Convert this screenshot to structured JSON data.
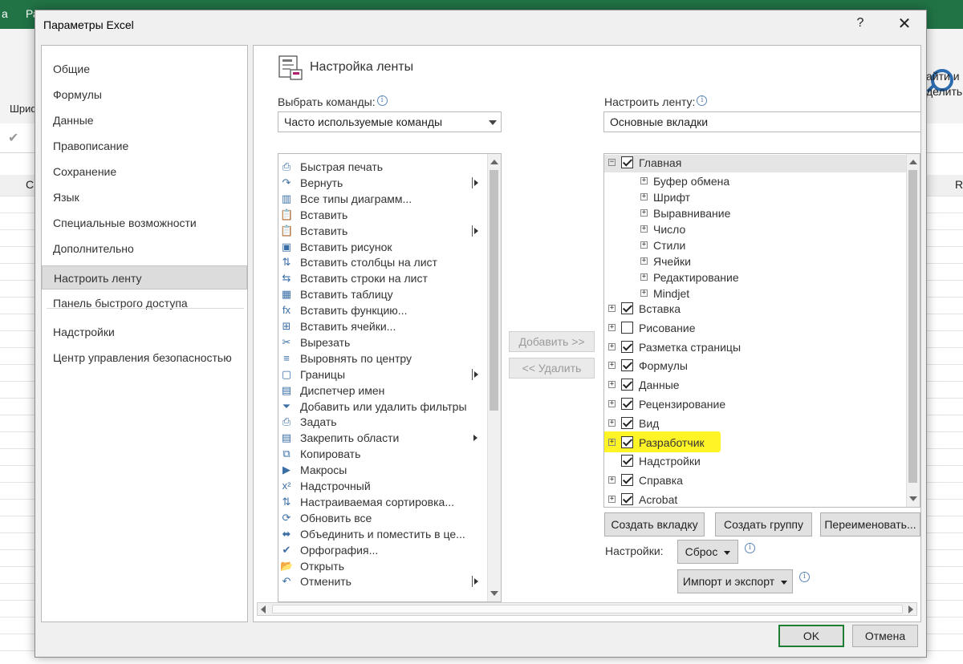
{
  "background": {
    "titlebar_frag_left": "а",
    "titlebar_frag_2": "Ра",
    "ribbon_frag_left": "Шриф",
    "ribbon_frag_right_1": "айти и",
    "ribbon_frag_right_2": "делить",
    "colhdr_frag_left": "С",
    "colhdr_frag_right": "R",
    "accent": "#217346"
  },
  "dialog": {
    "title": "Параметры Excel",
    "help": "?",
    "close": "✕",
    "nav": [
      {
        "label": "Общие"
      },
      {
        "label": "Формулы"
      },
      {
        "label": "Данные"
      },
      {
        "label": "Правописание"
      },
      {
        "label": "Сохранение"
      },
      {
        "label": "Язык"
      },
      {
        "label": "Специальные возможности"
      },
      {
        "label": "Дополнительно"
      },
      {
        "label": "Настроить ленту",
        "active": true
      },
      {
        "label": "Панель быстрого доступа"
      },
      {
        "label": "Надстройки"
      },
      {
        "label": "Центр управления безопасностью"
      }
    ],
    "section_title": "Настройка ленты",
    "choose_label": "Выбрать команды:",
    "choose_value": "Часто используемые команды",
    "customize_label": "Настроить ленту:",
    "customize_value": "Основные вкладки",
    "commands": [
      {
        "label": "Быстрая печать",
        "icon": "quick-print-icon",
        "glyph": "⎙"
      },
      {
        "label": "Вернуть",
        "icon": "redo-icon",
        "glyph": "↷",
        "submenu": true
      },
      {
        "label": "Все типы диаграмм...",
        "icon": "chart-icon",
        "glyph": "▥"
      },
      {
        "label": "Вставить",
        "icon": "paste-icon",
        "glyph": "📋"
      },
      {
        "label": "Вставить",
        "icon": "paste-icon",
        "glyph": "📋",
        "submenu": true
      },
      {
        "label": "Вставить рисунок",
        "icon": "picture-icon",
        "glyph": "▣"
      },
      {
        "label": "Вставить столбцы на лист",
        "icon": "insert-columns-icon",
        "glyph": "⇅"
      },
      {
        "label": "Вставить строки на лист",
        "icon": "insert-rows-icon",
        "glyph": "⇆"
      },
      {
        "label": "Вставить таблицу",
        "icon": "table-icon",
        "glyph": "▦"
      },
      {
        "label": "Вставить функцию...",
        "icon": "function-icon",
        "glyph": "fx"
      },
      {
        "label": "Вставить ячейки...",
        "icon": "insert-cells-icon",
        "glyph": "⊞"
      },
      {
        "label": "Вырезать",
        "icon": "scissors-icon",
        "glyph": "✂"
      },
      {
        "label": "Выровнять по центру",
        "icon": "align-center-icon",
        "glyph": "≡"
      },
      {
        "label": "Границы",
        "icon": "borders-icon",
        "glyph": "▢",
        "submenu": true
      },
      {
        "label": "Диспетчер имен",
        "icon": "name-manager-icon",
        "glyph": "▤"
      },
      {
        "label": "Добавить или удалить фильтры",
        "icon": "filter-icon",
        "glyph": "⏷"
      },
      {
        "label": "Задать",
        "icon": "set-print-area-icon",
        "glyph": "⎙"
      },
      {
        "label": "Закрепить области",
        "icon": "freeze-panes-icon",
        "glyph": "▤",
        "submenu_plain": true
      },
      {
        "label": "Копировать",
        "icon": "copy-icon",
        "glyph": "⧉"
      },
      {
        "label": "Макросы",
        "icon": "macros-icon",
        "glyph": "▶"
      },
      {
        "label": "Надстрочный",
        "icon": "superscript-icon",
        "glyph": "x²"
      },
      {
        "label": "Настраиваемая сортировка...",
        "icon": "sort-icon",
        "glyph": "⇅"
      },
      {
        "label": "Обновить все",
        "icon": "refresh-icon",
        "glyph": "⟳"
      },
      {
        "label": "Объединить и поместить в це...",
        "icon": "merge-icon",
        "glyph": "⬌"
      },
      {
        "label": "Орфография...",
        "icon": "spelling-icon",
        "glyph": "✔"
      },
      {
        "label": "Открыть",
        "icon": "open-folder-icon",
        "glyph": "📂"
      },
      {
        "label": "Отменить",
        "icon": "undo-icon",
        "glyph": "↶",
        "submenu": true
      }
    ],
    "add_button": "Добавить >>",
    "remove_button": "<< Удалить",
    "tree": {
      "main": {
        "label": "Главная",
        "checked": true,
        "expanded": true
      },
      "groups": [
        "Буфер обмена",
        "Шрифт",
        "Выравнивание",
        "Число",
        "Стили",
        "Ячейки",
        "Редактирование",
        "Mindjet"
      ],
      "tabs": [
        {
          "label": "Вставка",
          "checked": true
        },
        {
          "label": "Рисование",
          "checked": false
        },
        {
          "label": "Разметка страницы",
          "checked": true
        },
        {
          "label": "Формулы",
          "checked": true
        },
        {
          "label": "Данные",
          "checked": true
        },
        {
          "label": "Рецензирование",
          "checked": true
        },
        {
          "label": "Вид",
          "checked": true
        },
        {
          "label": "Разработчик",
          "checked": true,
          "highlight": true
        },
        {
          "label": "Надстройки",
          "checked": true,
          "noexp": true
        },
        {
          "label": "Справка",
          "checked": true
        },
        {
          "label": "Acrobat",
          "checked": true
        }
      ]
    },
    "new_tab_button": "Создать вкладку",
    "new_group_button": "Создать группу",
    "rename_button": "Переименовать...",
    "settings_label": "Настройки:",
    "reset_button": "Сброс",
    "import_export_button": "Импорт и экспорт",
    "ok_button": "OK",
    "cancel_button": "Отмена"
  }
}
